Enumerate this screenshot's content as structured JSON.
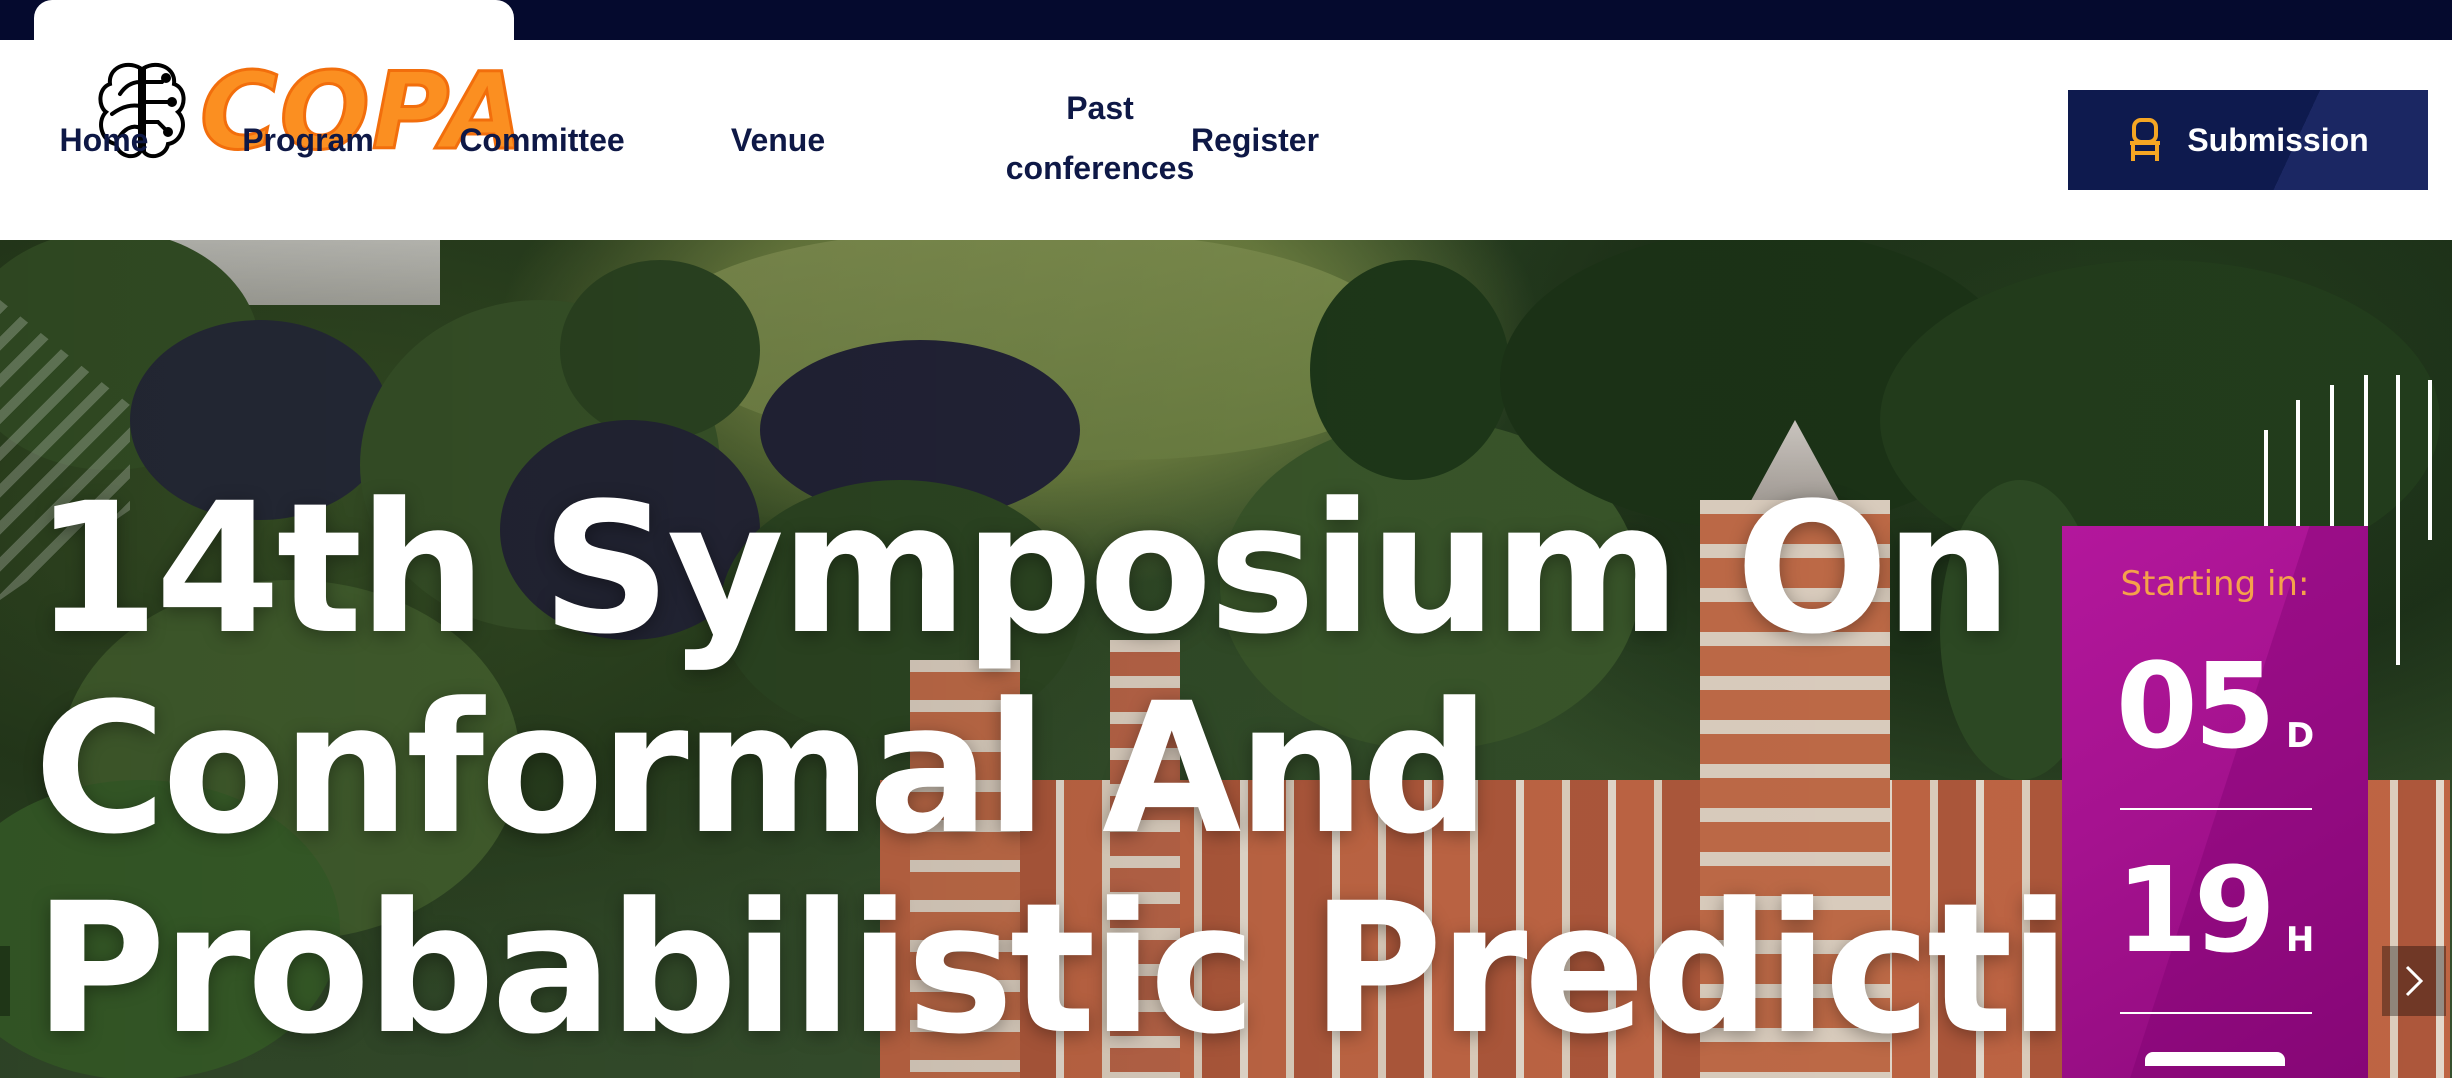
{
  "logo": {
    "text": "COPA"
  },
  "nav": {
    "items": [
      {
        "label": "Home"
      },
      {
        "label": "Program"
      },
      {
        "label": "Committee"
      },
      {
        "label": "Venue"
      },
      {
        "label_line1": "Past",
        "label_line2": "conferences"
      },
      {
        "label": "Register"
      }
    ]
  },
  "submission": {
    "label": "Submission",
    "icon": "chair-icon"
  },
  "hero": {
    "title_line1": "14th Symposium On",
    "title_line2": "Conformal And",
    "title_line3": "Probabilistic Prediction"
  },
  "countdown": {
    "label": "Starting in:",
    "days": "05",
    "days_unit": "D",
    "hours": "19",
    "hours_unit": "H"
  },
  "colors": {
    "brand_orange": "#fb8f21",
    "navy": "#0e1a4e",
    "countdown_magenta": "#b3179c",
    "countdown_label": "#f5a24a"
  }
}
